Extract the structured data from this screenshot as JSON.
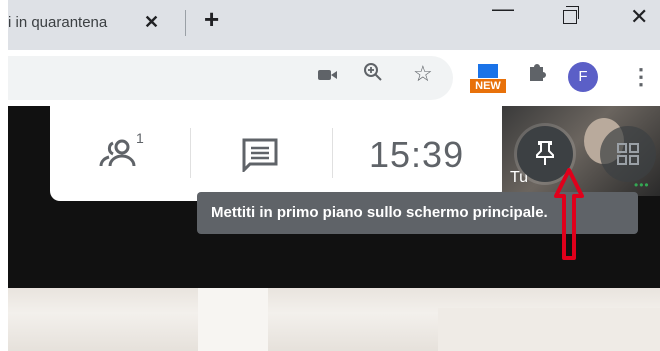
{
  "browser": {
    "tab_title": "i in quarantena",
    "tab_close": "✕",
    "new_tab": "+",
    "window_minimize": "—",
    "window_close": "✕",
    "extension_badge": "NEW",
    "avatar_letter": "F",
    "menu": "⋮"
  },
  "meet": {
    "people_count": "1",
    "clock": "15:39",
    "self_label": "Tu",
    "pin_tooltip": "Mettiti in primo piano sullo schermo principale."
  },
  "icons": {
    "video": "video-camera-icon",
    "zoom": "zoom-in-icon",
    "bookmark": "star-icon",
    "extensions": "puzzle-icon",
    "people": "people-icon",
    "chat": "chat-icon",
    "pin": "pin-icon",
    "layout": "grid-icon"
  },
  "colors": {
    "avatar": "#5b5fc7",
    "tooltip": "#5f6368",
    "annotation_arrow": "#e0001b",
    "meet_dark": "#111111"
  }
}
